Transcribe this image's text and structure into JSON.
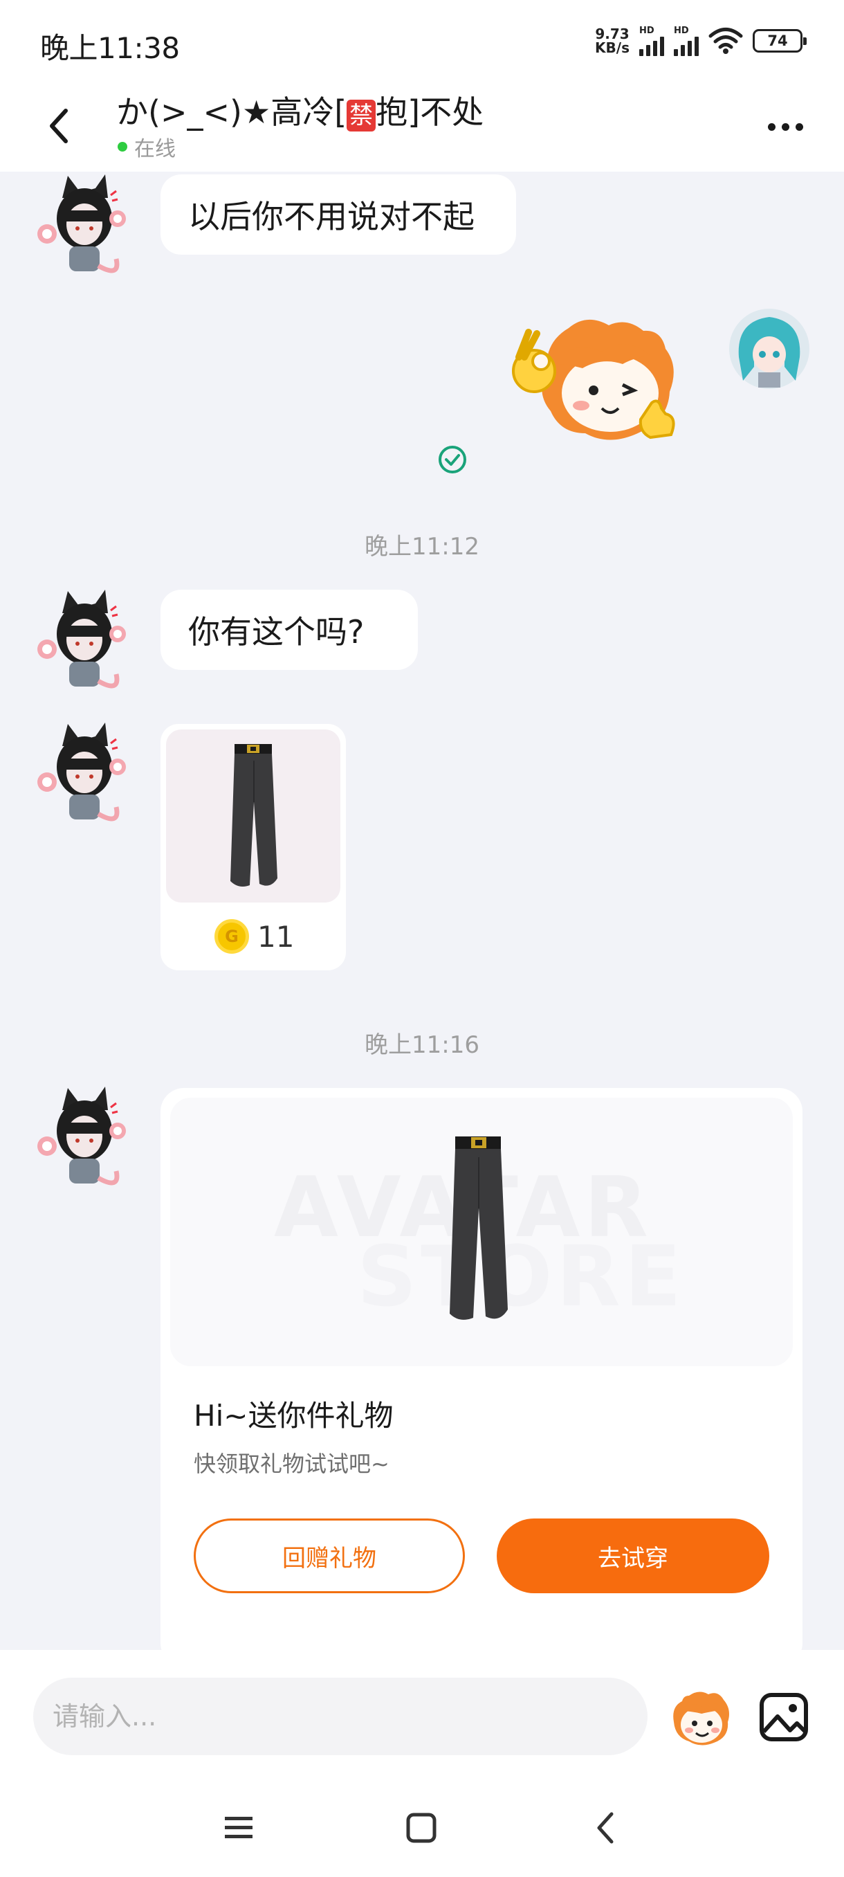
{
  "status_bar": {
    "time": "晚上11:38",
    "net_speed_value": "9.73",
    "net_speed_unit": "KB/s",
    "hd_label": "HD",
    "battery": "74"
  },
  "header": {
    "title_before": "か(>_<)★高冷[",
    "title_badge": "禁",
    "title_after": "抱]不处",
    "status": "在线"
  },
  "messages": {
    "msg1_text": "以后你不用说对不起",
    "time1": "晚上11:12",
    "msg2_text": "你有这个吗?",
    "product": {
      "price": "11",
      "coin_symbol": "G"
    },
    "time2": "晚上11:16",
    "gift": {
      "watermark_line1": "AVATAR",
      "watermark_line2": "STORE",
      "title": "Hi~送你件礼物",
      "subtitle": "快领取礼物试试吧~",
      "return_gift_label": "回赠礼物",
      "try_on_label": "去试穿"
    }
  },
  "input": {
    "placeholder": "请输入..."
  },
  "colors": {
    "accent": "#f76c0e",
    "online": "#2ecc40",
    "read_check": "#1aa37a",
    "background": "#f2f3f8"
  },
  "icons": [
    "back-arrow-icon",
    "more-dots-icon",
    "read-check-icon",
    "coin-icon",
    "emoji-sticker-icon",
    "image-icon",
    "menu-icon",
    "home-icon",
    "back-nav-icon"
  ]
}
